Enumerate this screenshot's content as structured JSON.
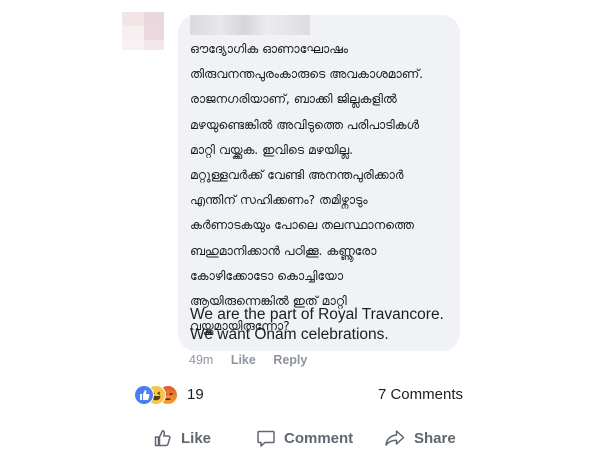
{
  "comment": {
    "author_avatar": "blurred",
    "lines_ml": [
      "ഔദ്യോഗിക ഓണാഘോഷം",
      "തിരുവനന്തപുരംകാരുടെ അവകാശമാണ്.",
      "രാജനഗരിയാണ്, ബാക്കി ജില്ലകളിൽ",
      "മഴയുണ്ടെങ്കിൽ അവിടുത്തെ പരിപാടികൾ",
      "മാറ്റി വയ്ക്കുക. ഇവിടെ മഴയില്ല.",
      "മറ്റുള്ളവർക്ക് വേണ്ടി അനന്തപുരിക്കാർ",
      "എന്തിന് സഹിക്കണം? തമിഴ്നാടും",
      "കർണാടകയും പോലെ തലസ്ഥാനത്തെ",
      "ബഹുമാനിക്കാൻ പഠിക്കൂ. കണ്ണൂരോ",
      "കോഴിക്കോടോ കൊച്ചിയോ",
      "ആയിരുന്നെങ്കിൽ ഇത് മാറ്റി",
      "വയ്ക്കുമായിരുന്നോ?"
    ],
    "lines_en": [
      "We are the part of Royal Travancore.",
      "We want Onam celebrations."
    ],
    "time": "49m",
    "like_label": "Like",
    "reply_label": "Reply"
  },
  "post_footer": {
    "reaction_icons": [
      "like-icon",
      "haha-icon",
      "angry-icon"
    ],
    "reaction_count": "19",
    "comments_count": "7 Comments",
    "actions": {
      "like": "Like",
      "comment": "Comment",
      "share": "Share"
    }
  },
  "colors": {
    "bubble": "#f1f2f6",
    "meta_text": "#8d949e",
    "action_text": "#606770",
    "like_blue": "#4a7ff0"
  }
}
